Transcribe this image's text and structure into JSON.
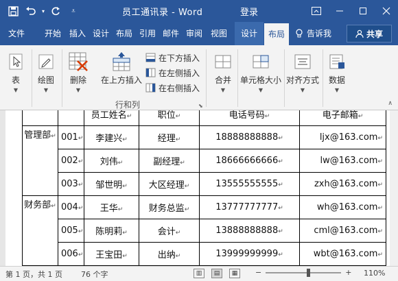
{
  "window": {
    "title": "员工通讯录 - Word",
    "login": "登录"
  },
  "quick_access": {
    "save_icon": "save-icon",
    "undo_icon": "undo-icon",
    "redo_icon": "redo-icon",
    "customize_icon": "customize-qat-icon"
  },
  "tabs": [
    "文件",
    "开始",
    "插入",
    "设计",
    "布局",
    "引用",
    "邮件",
    "审阅",
    "视图",
    "设计",
    "布局"
  ],
  "active_tab_index": 10,
  "tell_me": "告诉我",
  "share": "共享",
  "ribbon": {
    "table": "表",
    "draw": "绘图",
    "delete": "删除",
    "insert_above": "在上方插入",
    "insert_below": "在下方插入",
    "insert_left": "在左侧插入",
    "insert_right": "在右侧插入",
    "group_rows_cols": "行和列",
    "merge": "合并",
    "cell_size": "单元格大小",
    "alignment": "对齐方式",
    "data": "数据"
  },
  "table": {
    "header_partial": [
      "员工姓名",
      "职位",
      "电话号码",
      "电子邮箱"
    ],
    "groups": [
      {
        "dept": "管理部",
        "rows": [
          {
            "id": "001",
            "name": "李建兴",
            "title": "经理",
            "phone": "18888888888",
            "email": "ljx@163.com"
          },
          {
            "id": "002",
            "name": "刘伟",
            "title": "副经理",
            "phone": "18666666666",
            "email": "lw@163.com"
          },
          {
            "id": "003",
            "name": "邹世明",
            "title": "大区经理",
            "phone": "13555555555",
            "email": "zxh@163.com"
          }
        ]
      },
      {
        "dept": "财务部",
        "rows": [
          {
            "id": "004",
            "name": "王华",
            "title": "财务总监",
            "phone": "13777777777",
            "email": "wh@163.com"
          },
          {
            "id": "005",
            "name": "陈明莉",
            "title": "会计",
            "phone": "13888888888",
            "email": "cml@163.com"
          },
          {
            "id": "006",
            "name": "王宝田",
            "title": "出纳",
            "phone": "13999999999",
            "email": "wbt@163.com"
          }
        ]
      }
    ]
  },
  "status": {
    "page": "第 1 页，共 1 页",
    "words": "76 个字",
    "zoom": "110%"
  }
}
